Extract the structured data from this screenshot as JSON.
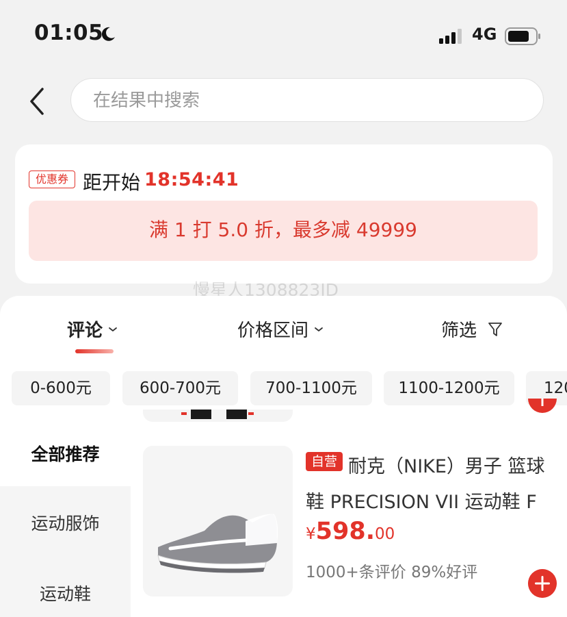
{
  "status_bar": {
    "time": "01:05",
    "network": "4G"
  },
  "search": {
    "placeholder": "在结果中搜索"
  },
  "coupon": {
    "badge": "优惠券",
    "start_label": "距开始",
    "countdown": "18:54:41",
    "offer": "满 1 打 5.0 折，最多减 49999"
  },
  "watermark": "慢星人1308823JD",
  "sort_tabs": [
    {
      "label": "评论"
    },
    {
      "label": "价格区间"
    },
    {
      "label": "筛选"
    }
  ],
  "price_chips": [
    "0-600元",
    "600-700元",
    "700-1100元",
    "1100-1200元",
    "120"
  ],
  "categories": [
    "全部推荐",
    "运动服饰",
    "运动鞋"
  ],
  "product": {
    "badge": "自营",
    "title": "耐克（NIKE）男子 篮球鞋 PRECISION VII 运动鞋 F",
    "price_symbol": "¥",
    "price_int": "598.",
    "price_dec": "00",
    "reviews": "1000+条评价  89%好评"
  },
  "colors": {
    "accent": "#e2332a",
    "offer_bg": "#fde5e3"
  }
}
